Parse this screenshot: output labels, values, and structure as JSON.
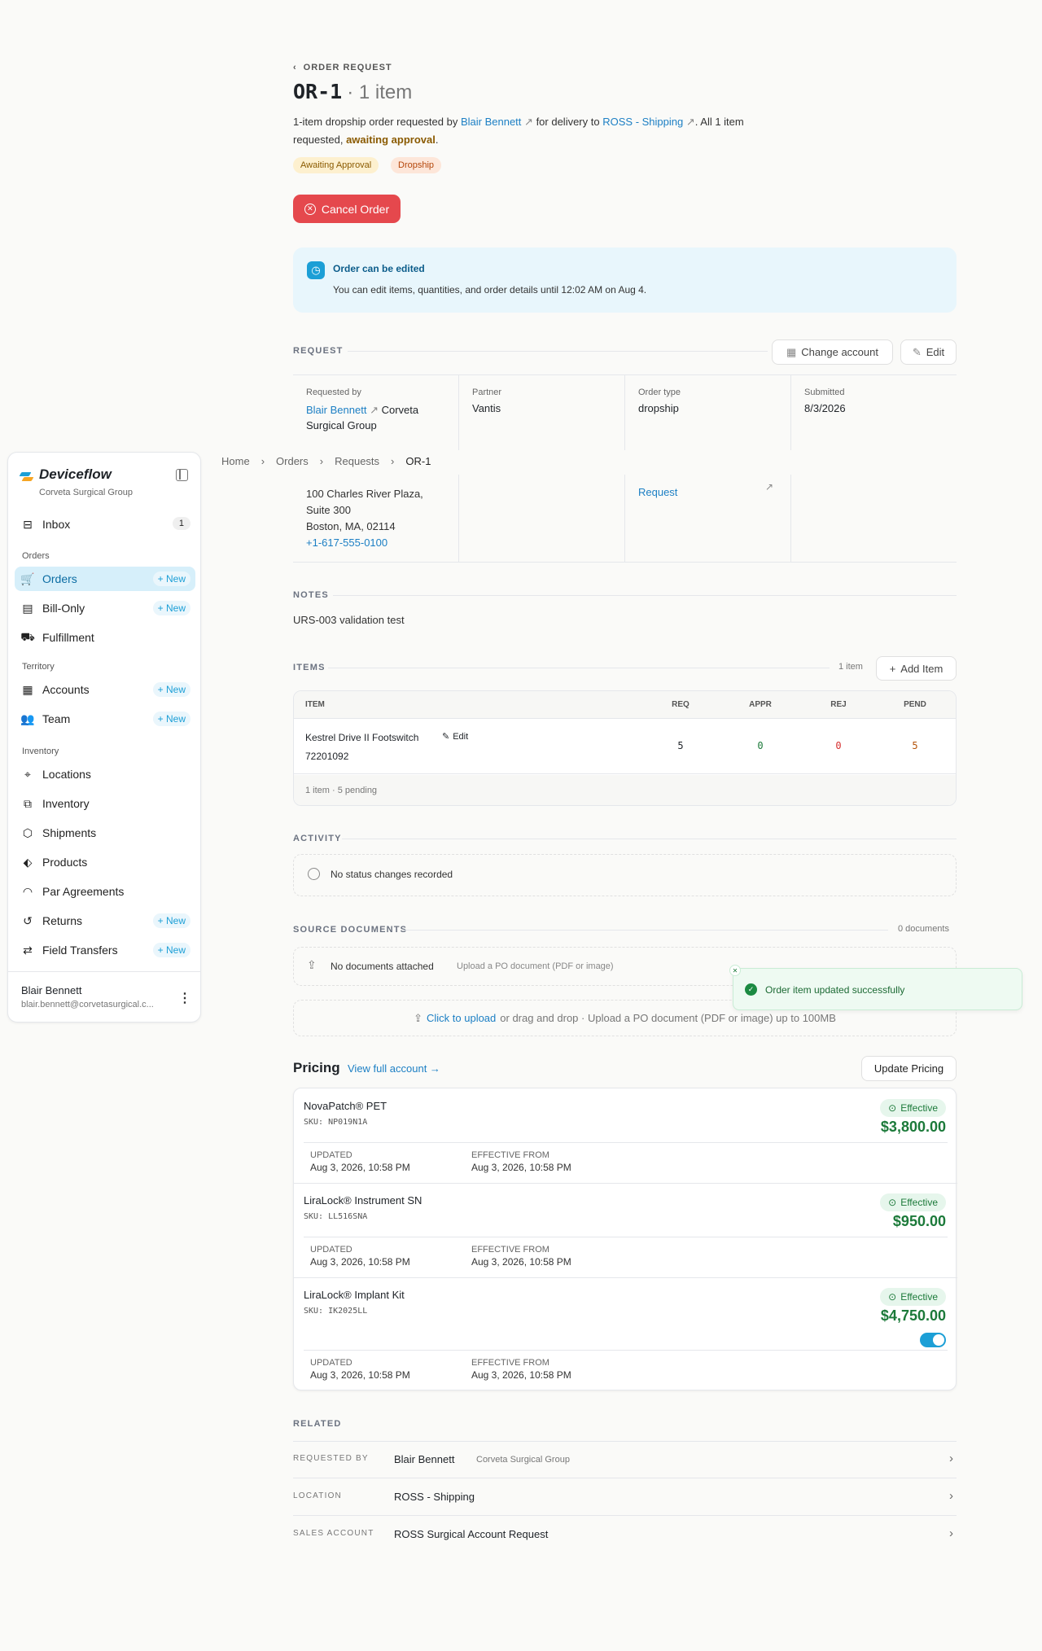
{
  "header": {
    "back_label": "ORDER REQUEST",
    "order_id": "OR-1",
    "item_count": "· 1 item",
    "desc_pre": "1-item dropship order requested by",
    "requester": "Blair Bennett",
    "desc_mid": "for delivery to",
    "location": "ROSS - Shipping",
    "desc_post": ". All 1 item",
    "desc_line2_pre": "requested,",
    "desc_status": "awaiting approval",
    "desc_line2_post": ".",
    "badges": [
      "Awaiting Approval",
      "Dropship"
    ],
    "cancel_label": "Cancel Order"
  },
  "notice": {
    "title": "Order can be edited",
    "body": "You can edit items, quantities, and order details until 12:02 AM on Aug 4."
  },
  "request": {
    "section_label": "REQUEST",
    "change_account_label": "Change account",
    "edit_label": "Edit",
    "fields": [
      {
        "label": "Requested by",
        "value_link": "Blair Bennett",
        "value_rest": "Corveta",
        "value_line2": "Surgical Group"
      },
      {
        "label": "Partner",
        "value": "Vantis"
      },
      {
        "label": "Order type",
        "value": "dropship"
      },
      {
        "label": "Submitted",
        "value": "8/3/2026"
      }
    ],
    "address": [
      "100 Charles River Plaza,",
      "Suite 300",
      "Boston, MA, 02114"
    ],
    "phone": "+1-617-555-0100",
    "account_link_tail": "Request"
  },
  "breadcrumb": [
    "Home",
    "Orders",
    "Requests",
    "OR-1"
  ],
  "notes": {
    "label": "NOTES",
    "text": "URS-003 validation test"
  },
  "items": {
    "label": "ITEMS",
    "count": "1 item",
    "add_label": "Add Item",
    "columns": [
      "ITEM",
      "REQ",
      "APPR",
      "REJ",
      "PEND"
    ],
    "rows": [
      {
        "name": "Kestrel Drive II Footswitch",
        "edit": "Edit",
        "sku": "72201092",
        "req": "5",
        "appr": "0",
        "rej": "0",
        "pend": "5"
      }
    ],
    "footer": "1 item · 5 pending"
  },
  "activity": {
    "label": "ACTIVITY",
    "empty": "No status changes recorded"
  },
  "documents": {
    "label": "SOURCE DOCUMENTS",
    "count": "0 documents",
    "empty_title": "No documents attached",
    "empty_hint": "Upload a PO document (PDF or image)",
    "upload_link": "Click to upload",
    "upload_rest": "or drag and drop · Upload a PO document (PDF or image) up to 100MB"
  },
  "toast": {
    "message": "Order item updated successfully"
  },
  "pricing": {
    "title": "Pricing",
    "view_link": "View full account →",
    "update_label": "Update Pricing",
    "products": [
      {
        "name": "NovaPatch® PET",
        "sku": "SKU: NP019N1A",
        "status": "Effective",
        "price": "$3,800.00",
        "updated_label": "UPDATED",
        "updated": "Aug 3, 2026, 10:58 PM",
        "eff_label": "EFFECTIVE FROM",
        "eff": "Aug 3, 2026, 10:58 PM"
      },
      {
        "name": "LiraLock® Instrument SN",
        "sku": "SKU: LL516SNA",
        "status": "Effective",
        "price": "$950.00",
        "updated_label": "UPDATED",
        "updated": "Aug 3, 2026, 10:58 PM",
        "eff_label": "EFFECTIVE FROM",
        "eff": "Aug 3, 2026, 10:58 PM"
      },
      {
        "name": "LiraLock® Implant Kit",
        "sku": "SKU: IK2025LL",
        "status": "Effective",
        "price": "$4,750.00",
        "updated_label": "UPDATED",
        "updated": "Aug 3, 2026, 10:58 PM",
        "eff_label": "EFFECTIVE FROM",
        "eff": "Aug 3, 2026, 10:58 PM"
      }
    ]
  },
  "related": {
    "label": "RELATED",
    "rows": [
      {
        "key": "REQUESTED BY",
        "value": "Blair Bennett",
        "sub": "Corveta Surgical Group"
      },
      {
        "key": "LOCATION",
        "value": "ROSS - Shipping",
        "sub": ""
      },
      {
        "key": "SALES ACCOUNT",
        "value": "ROSS Surgical Account Request",
        "sub": ""
      }
    ]
  },
  "sidebar": {
    "app_name": "Deviceflow",
    "org": "Corveta Surgical Group",
    "inbox_label": "Inbox",
    "inbox_count": "1",
    "new_label": "New",
    "sections": [
      "Orders",
      "Territory",
      "Inventory"
    ],
    "items": [
      "Orders",
      "Bill-Only",
      "Fulfillment",
      "Accounts",
      "Team",
      "Locations",
      "Inventory",
      "Shipments",
      "Products",
      "Par Agreements",
      "Returns",
      "Field Transfers"
    ],
    "user_name": "Blair Bennett",
    "user_email": "blair.bennett@corvetasurgical.c..."
  },
  "colors": {
    "accent": "#1c9fd6",
    "danger": "#e5484d",
    "success": "#1c7a3a",
    "warning": "#b45309"
  }
}
